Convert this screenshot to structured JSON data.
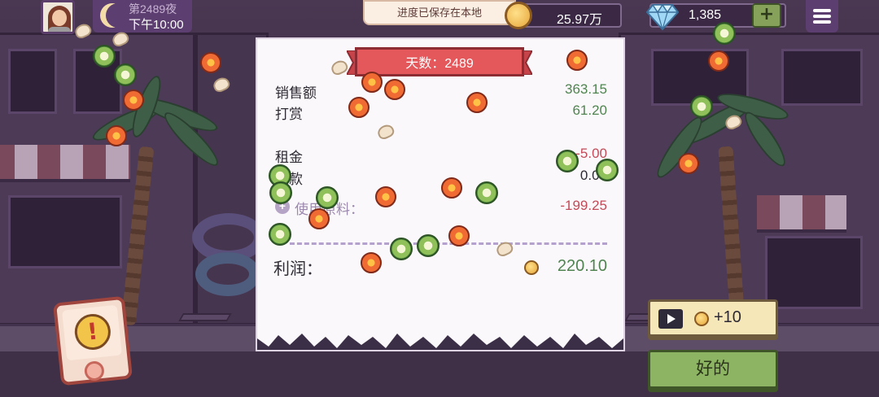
{
  "hud": {
    "night_label": "第2489夜",
    "time_label": "下午10:00",
    "save_toast": "进度已保存在本地",
    "money": "25.97万",
    "gems": "1,385",
    "add_gems_label": "+"
  },
  "receipt": {
    "day_banner": "天数：2489",
    "rows": [
      {
        "label": "销售额",
        "value": "363.15"
      },
      {
        "label": "打赏",
        "value": "61.20"
      },
      {
        "label": "租金",
        "value": "-5.00"
      },
      {
        "label": "贷款",
        "value": "0.00"
      },
      {
        "label": "使用原料：",
        "value": "-199.25"
      }
    ],
    "profit_label": "利润：",
    "profit_value": "220.10"
  },
  "buttons": {
    "ad_reward_label": "+10",
    "ok_label": "好的"
  },
  "icons": {
    "avatar": "avatar",
    "moon": "moon-icon",
    "coin": "coin-icon",
    "gem": "diamond-icon",
    "menu": "menu-icon",
    "play": "play-video-icon",
    "alert": "alert-icon"
  },
  "colors": {
    "positive": "#4f8450",
    "negative": "#c14b58",
    "banner": "#e4575b",
    "ok_button": "#8db463",
    "hud_panel": "#5c3e70"
  }
}
